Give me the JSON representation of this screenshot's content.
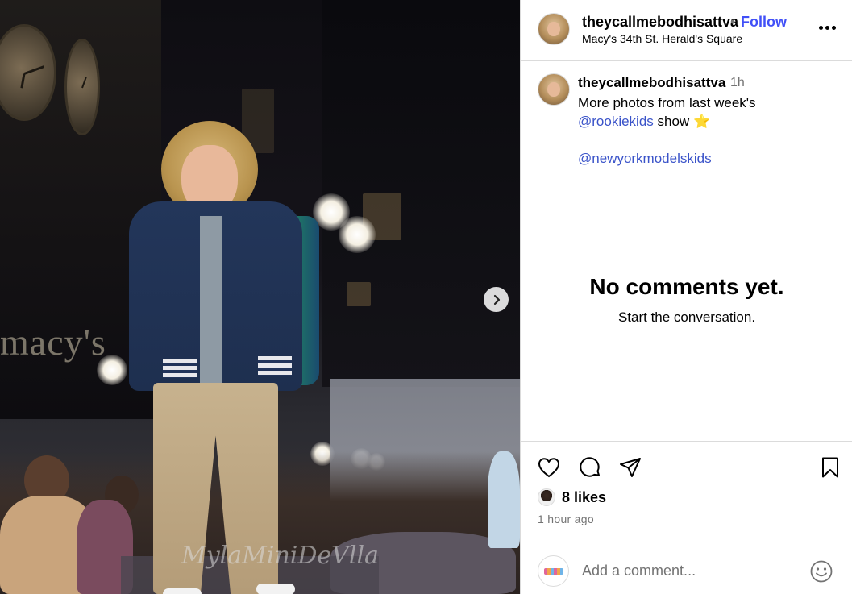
{
  "post": {
    "image": {
      "watermark": "MylaMiniDeVlla",
      "background_sign": "macy's"
    },
    "header": {
      "username": "theycallmebodhisattva",
      "separator": "•",
      "follow_label": "Follow",
      "location": "Macy's 34th St. Herald's Square"
    },
    "caption": {
      "username": "theycallmebodhisattva",
      "time": "1h",
      "text_line1": "More photos from last week's",
      "mention1": "@rookiekids",
      "text_after_mention1": " show ",
      "star": "⭐",
      "mention2": "@newyorkmodelskids"
    },
    "comments": {
      "empty_title": "No comments yet.",
      "empty_subtitle": "Start the conversation."
    },
    "actions": {
      "icons": [
        "heart-icon",
        "comment-icon",
        "share-icon",
        "bookmark-icon"
      ],
      "likes": "8 likes",
      "posted_ago": "1 hour ago"
    },
    "add_comment": {
      "placeholder": "Add a comment..."
    },
    "colors": {
      "follow": "#4150f7",
      "mention": "#3a53c9",
      "secondary_text": "#737373",
      "divider": "#dbdbdb"
    }
  }
}
